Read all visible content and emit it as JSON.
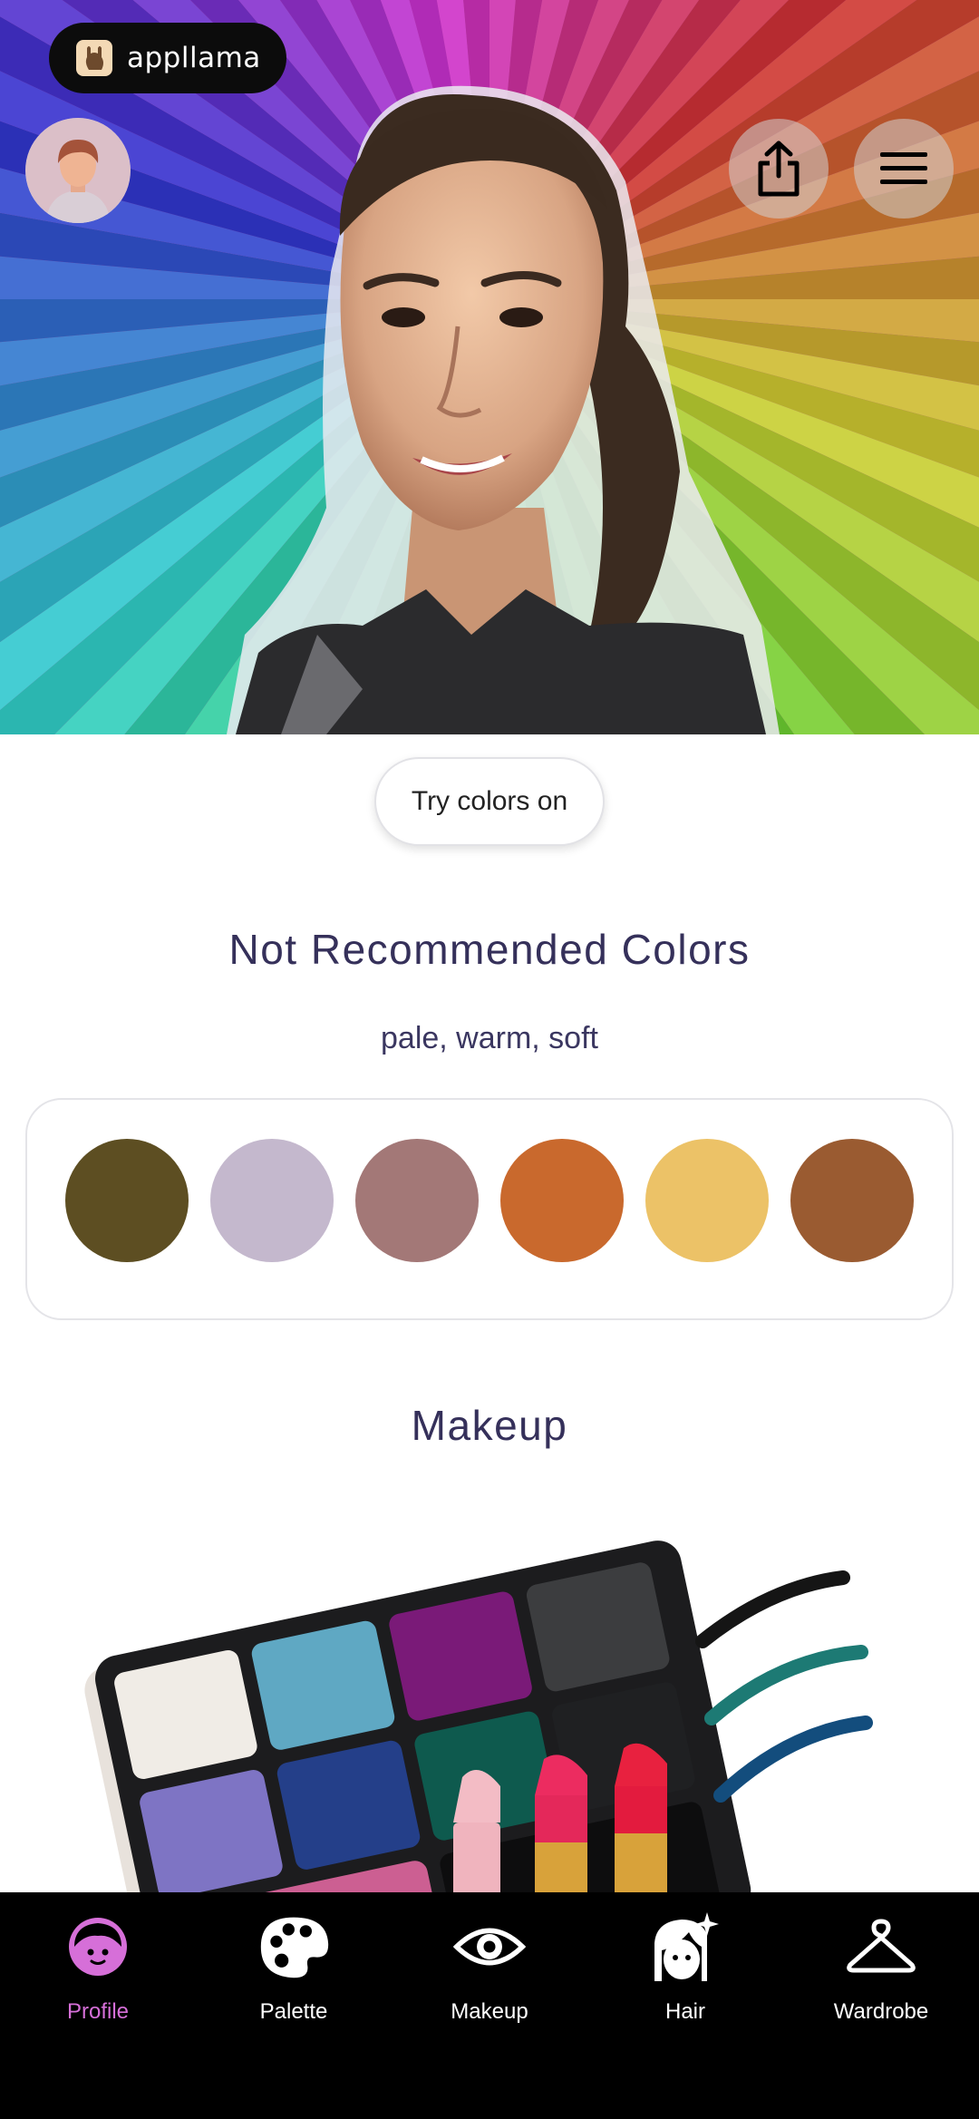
{
  "brand": {
    "name": "appllama"
  },
  "hero": {
    "share_icon": "share-icon",
    "menu_icon": "menu-icon",
    "avatar_icon": "avatar-icon"
  },
  "actions": {
    "try_colors_label": "Try colors on"
  },
  "not_recommended": {
    "title": "Not Recommended Colors",
    "subtitle": "pale, warm, soft",
    "swatches": [
      "#5d4e22",
      "#c4b8cd",
      "#a37877",
      "#c9692d",
      "#ecc267",
      "#9a5b31"
    ]
  },
  "makeup": {
    "title": "Makeup"
  },
  "nav": {
    "items": [
      {
        "label": "Profile",
        "icon": "face-icon",
        "active": true
      },
      {
        "label": "Palette",
        "icon": "palette-icon",
        "active": false
      },
      {
        "label": "Makeup",
        "icon": "eye-icon",
        "active": false
      },
      {
        "label": "Hair",
        "icon": "hair-icon",
        "active": false
      },
      {
        "label": "Wardrobe",
        "icon": "hanger-icon",
        "active": false
      }
    ],
    "active_color": "#d66fd8"
  }
}
